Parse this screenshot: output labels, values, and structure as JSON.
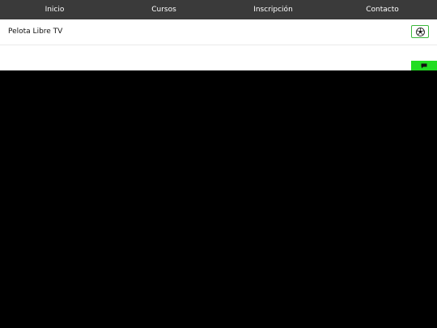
{
  "nav": {
    "items": [
      {
        "label": "Inicio"
      },
      {
        "label": "Cursos"
      },
      {
        "label": "Inscripción"
      },
      {
        "label": "Contacto"
      }
    ]
  },
  "header": {
    "brand": "Pelota Libre TV",
    "ball_icon": "soccer-ball-icon"
  },
  "chat": {
    "icon": "chat-bubble-icon"
  },
  "colors": {
    "nav_bg": "#3a3a3a",
    "accent": "#22dd22",
    "video_bg": "#000000"
  }
}
